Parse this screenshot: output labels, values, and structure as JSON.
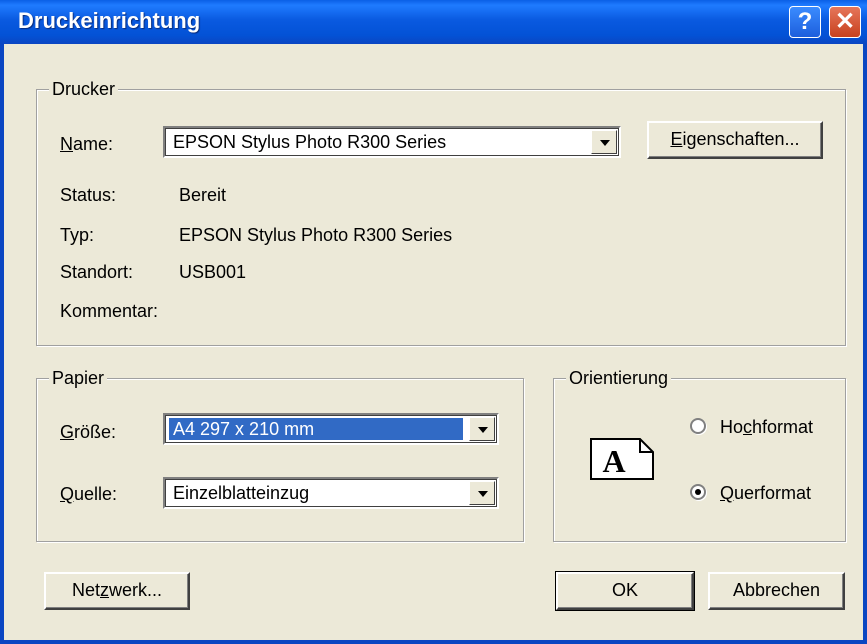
{
  "title": "Druckeinrichtung",
  "titlebar": {
    "help_glyph": "?",
    "close_glyph": "✕"
  },
  "printer": {
    "group_label": "Drucker",
    "name": {
      "label_pre": "",
      "label_ul": "N",
      "label_post": "ame:",
      "value": "EPSON Stylus Photo R300 Series"
    },
    "properties_button": {
      "ul": "E",
      "rest": "igenschaften..."
    },
    "status": {
      "label": "Status:",
      "value": "Bereit"
    },
    "type": {
      "label": "Typ:",
      "value": "EPSON Stylus Photo R300 Series"
    },
    "location": {
      "label": "Standort:",
      "value": "USB001"
    },
    "comment": {
      "label": "Kommentar:",
      "value": ""
    }
  },
  "paper": {
    "group_label": "Papier",
    "size": {
      "label_ul": "G",
      "label_post": "röße:",
      "value": "A4 297 x 210 mm"
    },
    "source": {
      "label_ul": "Q",
      "label_post": "uelle:",
      "value": "Einzelblatteinzug"
    }
  },
  "orientation": {
    "group_label": "Orientierung",
    "icon_letter": "A",
    "portrait": {
      "pre": "Ho",
      "ul": "c",
      "post": "hformat",
      "selected": false
    },
    "landscape": {
      "pre": "",
      "ul": "Q",
      "post": "uerformat",
      "selected": true
    }
  },
  "buttons": {
    "network": {
      "pre": "Net",
      "ul": "z",
      "post": "werk..."
    },
    "ok": "OK",
    "cancel": "Abbrechen"
  },
  "icons": [
    "help-icon",
    "close-icon",
    "dropdown-arrow-icon",
    "page-orientation-icon"
  ]
}
